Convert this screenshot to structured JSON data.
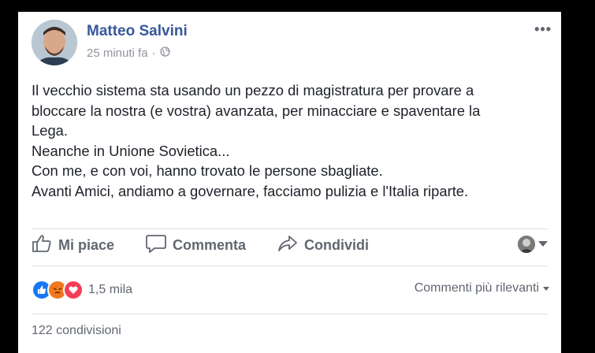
{
  "post": {
    "author": "Matteo Salvini",
    "timestamp": "25 minuti fa",
    "separator": "·",
    "privacy_icon": "globe-icon",
    "more_icon": "ellipsis-icon",
    "text_lines": [
      "Il vecchio sistema sta usando un pezzo di magistratura per provare a",
      "bloccare la nostra (e vostra) avanzata, per minacciare e spaventare la",
      "Lega.",
      "Neanche in Unione Sovietica...",
      "Con me, e con voi, hanno trovato le persone sbagliate.",
      "Avanti Amici, andiamo a governare, facciamo pulizia e l'Italia riparte."
    ]
  },
  "actions": {
    "like_label": "Mi piace",
    "comment_label": "Commenta",
    "share_label": "Condividi"
  },
  "stats": {
    "reactions_count": "1,5 mila",
    "reactions": [
      "like",
      "angry",
      "love"
    ],
    "sort_label": "Commenti più rilevanti",
    "shares_label": "122 condivisioni"
  },
  "colors": {
    "author": "#365899",
    "meta": "#90949c",
    "action_text": "#606770",
    "like_blue": "#1877f2",
    "angry_orange": "#f0781e",
    "love_red": "#f33e58"
  }
}
